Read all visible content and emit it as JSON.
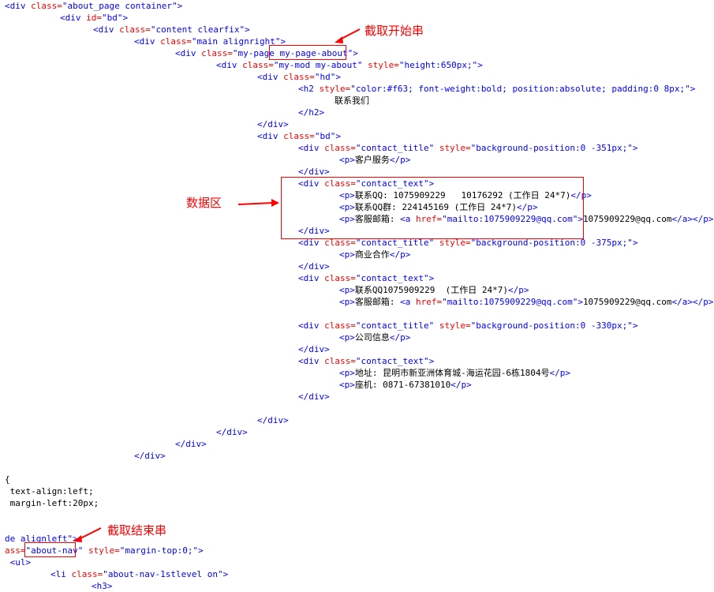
{
  "code_lines": [
    {
      "indent": 0,
      "segments": [
        [
          "tag",
          "<div "
        ],
        [
          "attr",
          "class="
        ],
        [
          "val",
          "\"about_page container\""
        ],
        [
          "tag",
          ">"
        ]
      ]
    },
    {
      "indent": 70,
      "segments": [
        [
          "tag",
          "<div "
        ],
        [
          "attr",
          "id="
        ],
        [
          "val",
          "\"bd\""
        ],
        [
          "tag",
          ">"
        ]
      ]
    },
    {
      "indent": 112,
      "segments": [
        [
          "tag",
          "<div "
        ],
        [
          "attr",
          "class="
        ],
        [
          "val",
          "\"content clearfix\""
        ],
        [
          "tag",
          ">"
        ]
      ]
    },
    {
      "indent": 164,
      "segments": [
        [
          "tag",
          "<div "
        ],
        [
          "attr",
          "class="
        ],
        [
          "val",
          "\"main alignright\""
        ],
        [
          "tag",
          ">"
        ]
      ]
    },
    {
      "indent": 216,
      "segments": [
        [
          "tag",
          "<div "
        ],
        [
          "attr",
          "class="
        ],
        [
          "val",
          "\"my-page my-page-about\""
        ],
        [
          "tag",
          ">"
        ]
      ]
    },
    {
      "indent": 268,
      "segments": [
        [
          "tag",
          "<div "
        ],
        [
          "attr",
          "class="
        ],
        [
          "val",
          "\"my-mod my-about\" "
        ],
        [
          "attr",
          "style="
        ],
        [
          "val",
          "\"height:650px;\""
        ],
        [
          "tag",
          ">"
        ]
      ]
    },
    {
      "indent": 320,
      "segments": [
        [
          "tag",
          "<div "
        ],
        [
          "attr",
          "class="
        ],
        [
          "val",
          "\"hd\""
        ],
        [
          "tag",
          ">"
        ]
      ]
    },
    {
      "indent": 372,
      "segments": [
        [
          "tag",
          "<h2 "
        ],
        [
          "attr",
          "style="
        ],
        [
          "val",
          "\"color:#f63; font-weight:bold; position:absolute; padding:0 8px;\""
        ],
        [
          "tag",
          ">"
        ]
      ]
    },
    {
      "indent": 418,
      "segments": [
        [
          "txt",
          "联系我们"
        ]
      ]
    },
    {
      "indent": 372,
      "segments": [
        [
          "tag",
          "</h2>"
        ]
      ]
    },
    {
      "indent": 320,
      "segments": [
        [
          "tag",
          "</div>"
        ]
      ]
    },
    {
      "indent": 320,
      "segments": [
        [
          "tag",
          "<div "
        ],
        [
          "attr",
          "class="
        ],
        [
          "val",
          "\"bd\""
        ],
        [
          "tag",
          ">"
        ]
      ]
    },
    {
      "indent": 372,
      "segments": [
        [
          "tag",
          "<div "
        ],
        [
          "attr",
          "class="
        ],
        [
          "val",
          "\"contact_title\" "
        ],
        [
          "attr",
          "style="
        ],
        [
          "val",
          "\"background-position:0 -351px;\""
        ],
        [
          "tag",
          ">"
        ]
      ]
    },
    {
      "indent": 424,
      "segments": [
        [
          "tag",
          "<p>"
        ],
        [
          "txt",
          "客户服务"
        ],
        [
          "tag",
          "</p>"
        ]
      ]
    },
    {
      "indent": 372,
      "segments": [
        [
          "tag",
          "</div>"
        ]
      ]
    },
    {
      "indent": 372,
      "segments": [
        [
          "tag",
          "<div "
        ],
        [
          "attr",
          "class="
        ],
        [
          "val",
          "\"contact_text\""
        ],
        [
          "tag",
          ">"
        ]
      ]
    },
    {
      "indent": 424,
      "segments": [
        [
          "tag",
          "<p>"
        ],
        [
          "txt",
          "联系QQ: 1075909229   10176292 (工作日 24*7)"
        ],
        [
          "tag",
          "</p>"
        ]
      ]
    },
    {
      "indent": 424,
      "segments": [
        [
          "tag",
          "<p>"
        ],
        [
          "txt",
          "联系QQ群: 224145169 (工作日 24*7)"
        ],
        [
          "tag",
          "</p>"
        ]
      ]
    },
    {
      "indent": 424,
      "segments": [
        [
          "tag",
          "<p>"
        ],
        [
          "txt",
          "客服邮箱: "
        ],
        [
          "tag",
          "<a "
        ],
        [
          "attr",
          "href="
        ],
        [
          "val",
          "\"mailto:1075909229@qq.com\""
        ],
        [
          "tag",
          ">"
        ],
        [
          "txt",
          "1075909229@qq.com"
        ],
        [
          "tag",
          "</a></p>"
        ]
      ]
    },
    {
      "indent": 372,
      "segments": [
        [
          "tag",
          "</div>"
        ]
      ]
    },
    {
      "indent": 372,
      "segments": [
        [
          "tag",
          "<div "
        ],
        [
          "attr",
          "class="
        ],
        [
          "val",
          "\"contact_title\" "
        ],
        [
          "attr",
          "style="
        ],
        [
          "val",
          "\"background-position:0 -375px;\""
        ],
        [
          "tag",
          ">"
        ]
      ]
    },
    {
      "indent": 424,
      "segments": [
        [
          "tag",
          "<p>"
        ],
        [
          "txt",
          "商业合作"
        ],
        [
          "tag",
          "</p>"
        ]
      ]
    },
    {
      "indent": 372,
      "segments": [
        [
          "tag",
          "</div>"
        ]
      ]
    },
    {
      "indent": 372,
      "segments": [
        [
          "tag",
          "<div "
        ],
        [
          "attr",
          "class="
        ],
        [
          "val",
          "\"contact_text\""
        ],
        [
          "tag",
          ">"
        ]
      ]
    },
    {
      "indent": 424,
      "segments": [
        [
          "tag",
          "<p>"
        ],
        [
          "txt",
          "联系QQ1075909229  (工作日 24*7)"
        ],
        [
          "tag",
          "</p>"
        ]
      ]
    },
    {
      "indent": 424,
      "segments": [
        [
          "tag",
          "<p>"
        ],
        [
          "txt",
          "客服邮箱: "
        ],
        [
          "tag",
          "<a "
        ],
        [
          "attr",
          "href="
        ],
        [
          "val",
          "\"mailto:1075909229@qq.com\""
        ],
        [
          "tag",
          ">"
        ],
        [
          "txt",
          "1075909229@qq.com"
        ],
        [
          "tag",
          "</a></p>"
        ]
      ]
    },
    {
      "indent": 372,
      "segments": [
        [
          "tag",
          "<div "
        ],
        [
          "attr",
          "class="
        ],
        [
          "val",
          "\"contact_title\" "
        ],
        [
          "attr",
          "style="
        ],
        [
          "val",
          "\"background-position:0 -330px;\""
        ],
        [
          "tag",
          ">"
        ]
      ]
    },
    {
      "indent": 424,
      "segments": [
        [
          "tag",
          "<p>"
        ],
        [
          "txt",
          "公司信息"
        ],
        [
          "tag",
          "</p>"
        ]
      ]
    },
    {
      "indent": 372,
      "segments": [
        [
          "tag",
          "</div>"
        ]
      ]
    },
    {
      "indent": 372,
      "segments": [
        [
          "tag",
          "<div "
        ],
        [
          "attr",
          "class="
        ],
        [
          "val",
          "\"contact_text\""
        ],
        [
          "tag",
          ">"
        ]
      ]
    },
    {
      "indent": 424,
      "segments": [
        [
          "tag",
          "<p>"
        ],
        [
          "txt",
          "地址: 昆明市新亚洲体育城-海运花园-6栋1804号"
        ],
        [
          "tag",
          "</p>"
        ]
      ]
    },
    {
      "indent": 424,
      "segments": [
        [
          "tag",
          "<p>"
        ],
        [
          "txt",
          "座机: 0871-67381010"
        ],
        [
          "tag",
          "</p>"
        ]
      ]
    },
    {
      "indent": 372,
      "segments": [
        [
          "tag",
          "</div>"
        ]
      ]
    },
    {
      "indent": 0,
      "segments": []
    },
    {
      "indent": 320,
      "segments": [
        [
          "tag",
          "</div>"
        ]
      ]
    },
    {
      "indent": 268,
      "segments": [
        [
          "tag",
          "</div>"
        ]
      ]
    },
    {
      "indent": 216,
      "segments": [
        [
          "tag",
          "</div>"
        ]
      ]
    },
    {
      "indent": 164,
      "segments": [
        [
          "tag",
          "</div>"
        ]
      ]
    },
    {
      "indent": 0,
      "segments": []
    },
    {
      "indent": 0,
      "segments": [
        [
          "txt",
          "{"
        ]
      ]
    },
    {
      "indent": 0,
      "segments": [
        [
          "txt",
          " text-align:left;"
        ]
      ]
    },
    {
      "indent": 0,
      "segments": [
        [
          "txt",
          " margin-left:20px;"
        ]
      ]
    },
    {
      "indent": 0,
      "segments": []
    },
    {
      "indent": 0,
      "segments": []
    },
    {
      "indent": 0,
      "segments": [
        [
          "val",
          "de alignleft\""
        ],
        [
          "tag",
          ">"
        ]
      ]
    },
    {
      "indent": 0,
      "segments": [
        [
          "attr",
          "ass="
        ],
        [
          "val",
          "\"about-nav\" "
        ],
        [
          "attr",
          "style="
        ],
        [
          "val",
          "\"margin-top:0;\""
        ],
        [
          "tag",
          ">"
        ]
      ]
    },
    {
      "indent": 0,
      "segments": [
        [
          "tag",
          " <ul>"
        ]
      ]
    },
    {
      "indent": 58,
      "segments": [
        [
          "tag",
          "<li "
        ],
        [
          "attr",
          "class="
        ],
        [
          "val",
          "\"about-nav-1stlevel on\""
        ],
        [
          "tag",
          ">"
        ]
      ]
    },
    {
      "indent": 110,
      "segments": [
        [
          "tag",
          "<h3>"
        ]
      ]
    }
  ],
  "annotations": {
    "start_label": "截取开始串",
    "data_label": "数据区",
    "end_label": "截取结束串"
  },
  "colors": {
    "tag": "#0000ff",
    "attribute": "#ff0000",
    "value": "#0000ff",
    "text": "#000000",
    "annotation": "#ff0000"
  }
}
